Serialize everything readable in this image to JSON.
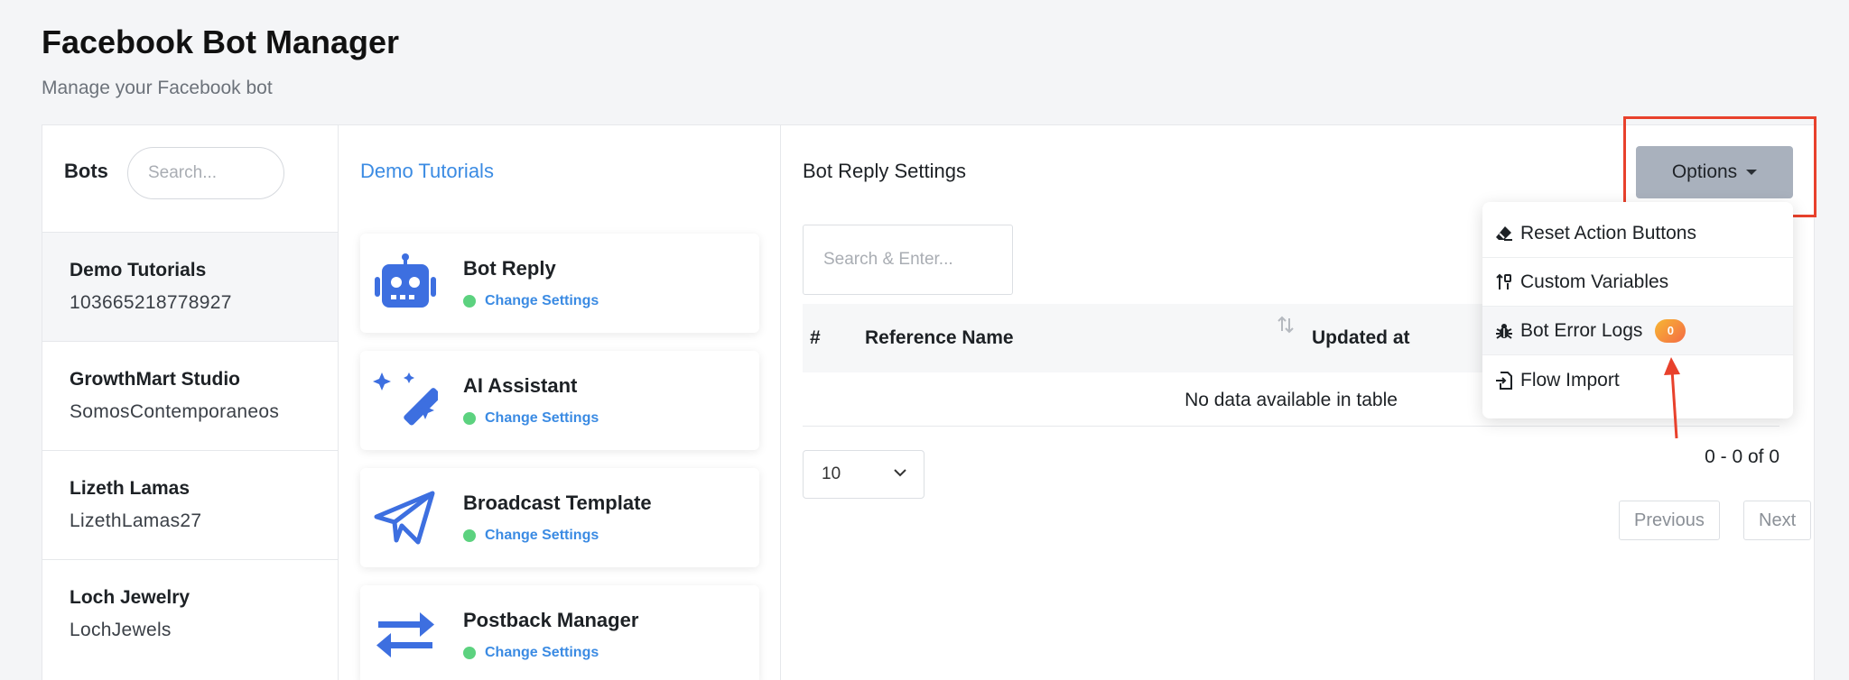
{
  "page": {
    "title": "Facebook Bot Manager",
    "subtitle": "Manage your Facebook bot"
  },
  "bots": {
    "label": "Bots",
    "search_placeholder": "Search...",
    "items": [
      {
        "name": "Demo Tutorials",
        "id": "103665218778927",
        "active": true
      },
      {
        "name": "GrowthMart Studio",
        "id": "SomosContemporaneos",
        "active": false
      },
      {
        "name": "Lizeth Lamas",
        "id": "LizethLamas27",
        "active": false
      },
      {
        "name": "Loch Jewelry",
        "id": "LochJewels",
        "active": false
      }
    ]
  },
  "tools": {
    "title": "Demo Tutorials",
    "items": [
      {
        "name": "Bot Reply",
        "link": "Change Settings",
        "icon": "robot-icon"
      },
      {
        "name": "AI Assistant",
        "link": "Change Settings",
        "icon": "magic-wand-icon"
      },
      {
        "name": "Broadcast Template",
        "link": "Change Settings",
        "icon": "paper-plane-icon"
      },
      {
        "name": "Postback Manager",
        "link": "Change Settings",
        "icon": "swap-arrows-icon"
      }
    ]
  },
  "main": {
    "title": "Bot Reply Settings",
    "search_placeholder": "Search & Enter...",
    "columns": [
      "#",
      "Reference Name",
      "Updated at"
    ],
    "empty_text": "No data available in table",
    "page_size": "10",
    "page_info": "0 - 0 of 0",
    "previous_label": "Previous",
    "next_label": "Next"
  },
  "options": {
    "label": "Options",
    "menu": [
      {
        "label": "Reset Action Buttons",
        "icon": "eraser-icon"
      },
      {
        "label": "Custom Variables",
        "icon": "sort-variables-icon"
      },
      {
        "label": "Bot Error Logs",
        "icon": "bug-icon",
        "badge": "0"
      },
      {
        "label": "Flow Import",
        "icon": "file-import-icon"
      }
    ]
  },
  "colors": {
    "accent": "#3b8be3",
    "icon_blue": "#3d6fe0",
    "status_green": "#5cd27f",
    "options_button": "#a9b1bd",
    "highlight": "#e8412c"
  }
}
